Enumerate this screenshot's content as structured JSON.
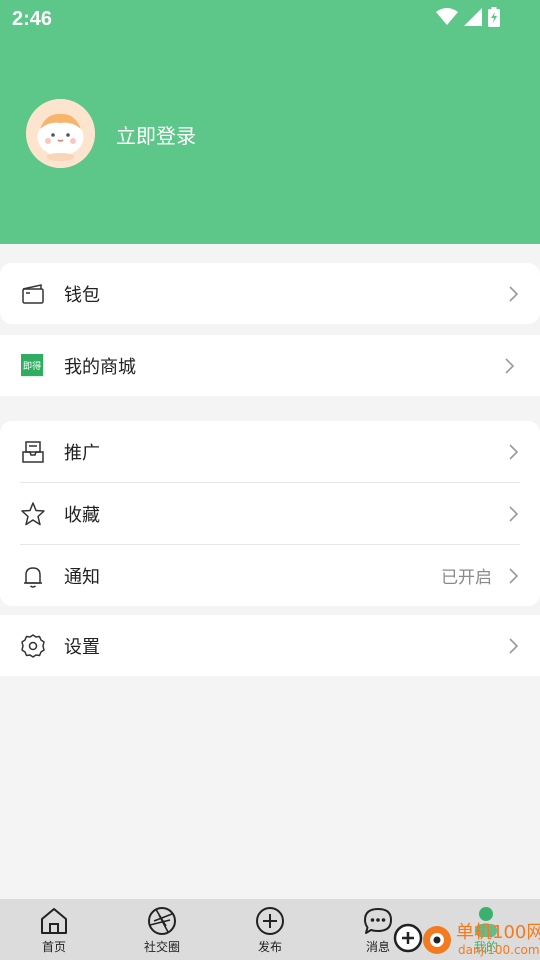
{
  "status_bar": {
    "time": "2:46"
  },
  "profile": {
    "login_text": "立即登录"
  },
  "colors": {
    "header": "#5dc689",
    "accent": "#3bb16f",
    "tab_bar": "#dcdcdc"
  },
  "menu_group1": [
    {
      "label": "钱包",
      "icon": "wallet-icon"
    }
  ],
  "menu_group2": [
    {
      "label": "我的商城",
      "icon": "mall-badge-icon",
      "badge_text": "即得"
    }
  ],
  "menu_group3": [
    {
      "label": "推广",
      "icon": "promotion-tray-icon"
    },
    {
      "label": "收藏",
      "icon": "star-icon"
    },
    {
      "label": "通知",
      "icon": "bell-icon",
      "value": "已开启"
    }
  ],
  "menu_group4": [
    {
      "label": "设置",
      "icon": "gear-icon"
    }
  ],
  "tabbar": [
    {
      "label": "首页",
      "icon": "home-icon"
    },
    {
      "label": "社交圈",
      "icon": "aperture-icon"
    },
    {
      "label": "发布",
      "icon": "plus-circle-icon"
    },
    {
      "label": "消息",
      "icon": "chat-bubble-icon"
    },
    {
      "label": "我的",
      "icon": "profile-icon",
      "active": true
    }
  ],
  "watermark": {
    "text_cn": "单机100网",
    "text_url": "danji100.com"
  }
}
